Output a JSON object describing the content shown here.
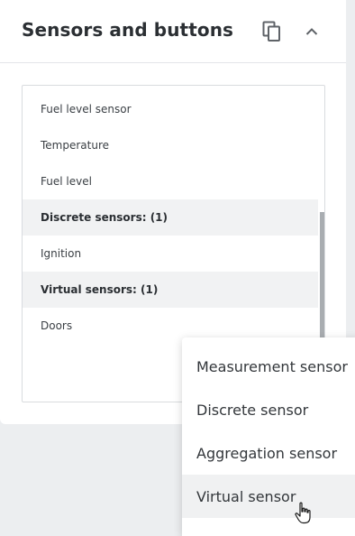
{
  "panel": {
    "title": "Sensors and buttons",
    "copy_icon": "copy-icon",
    "collapse_icon": "chevron-up-icon"
  },
  "sensor_list": [
    {
      "label": "Fuel level sensor",
      "kind": "item"
    },
    {
      "label": "Temperature",
      "kind": "item"
    },
    {
      "label": "Fuel level",
      "kind": "item"
    },
    {
      "label": "Discrete sensors: (1)",
      "kind": "group"
    },
    {
      "label": "Ignition",
      "kind": "item"
    },
    {
      "label": "Virtual sensors: (1)",
      "kind": "group"
    },
    {
      "label": "Doors",
      "kind": "item"
    }
  ],
  "add_menu": {
    "items": [
      {
        "label": "Measurement sensor"
      },
      {
        "label": "Discrete sensor"
      },
      {
        "label": "Aggregation sensor"
      },
      {
        "label": "Virtual sensor",
        "hovered": true
      }
    ]
  },
  "colors": {
    "panel_bg": "#ffffff",
    "page_bg": "#eceef0",
    "group_row_bg": "#f1f2f3",
    "icon_color": "#5f6368"
  }
}
